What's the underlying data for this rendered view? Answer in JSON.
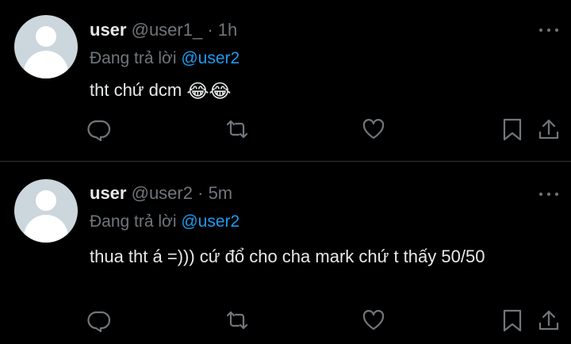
{
  "tweets": [
    {
      "display_name": "user",
      "handle": "@user1_",
      "separator": "·",
      "time": "1h",
      "replying_label": "Đang trả lời",
      "replying_to": "@user2",
      "text": "tht chứ dcm",
      "emoji": "😂😂",
      "avatar_icon": "default-avatar-icon",
      "more_icon": "more-options-icon",
      "actions": [
        "reply-icon",
        "retweet-icon",
        "like-icon",
        "bookmark-icon",
        "share-icon"
      ]
    },
    {
      "display_name": "user",
      "handle": "@user2",
      "separator": "·",
      "time": "5m",
      "replying_label": "Đang trả lời",
      "replying_to": "@user2",
      "text": "thua tht á =))) cứ đổ cho cha mark chứ t thấy 50/50",
      "avatar_icon": "default-avatar-icon",
      "more_icon": "more-options-icon",
      "actions": [
        "reply-icon",
        "retweet-icon",
        "like-icon",
        "bookmark-icon",
        "share-icon"
      ]
    }
  ],
  "colors": {
    "background": "#000000",
    "text": "#e7e9ea",
    "secondary_text": "#71767b",
    "link": "#1d9bf0",
    "divider": "#2f3336",
    "avatar_bg": "#ccd6dd"
  }
}
